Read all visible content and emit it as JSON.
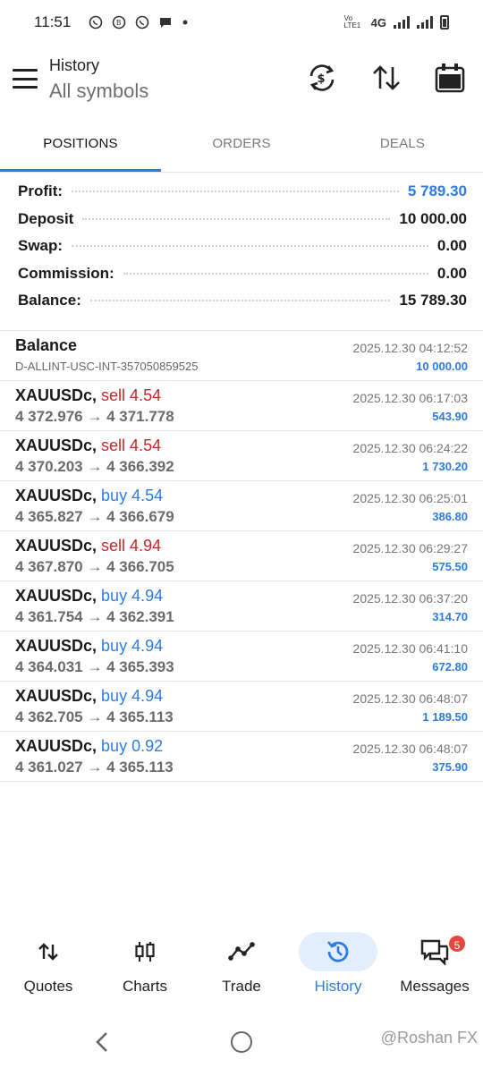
{
  "status_bar": {
    "time": "11:51",
    "network": "4G",
    "volte": "Vo LTE1",
    "icons": [
      "whatsapp-icon",
      "whatsapp-business-icon",
      "whatsapp-icon",
      "chat-icon",
      "dot"
    ]
  },
  "header": {
    "title": "History",
    "subtitle": "All symbols"
  },
  "tabs": [
    {
      "label": "POSITIONS",
      "active": true
    },
    {
      "label": "ORDERS",
      "active": false
    },
    {
      "label": "DEALS",
      "active": false
    }
  ],
  "summary": {
    "profit_label": "Profit:",
    "profit_value": "5 789.30",
    "deposit_label": "Deposit",
    "deposit_value": "10 000.00",
    "swap_label": "Swap:",
    "swap_value": "0.00",
    "commission_label": "Commission:",
    "commission_value": "0.00",
    "balance_label": "Balance:",
    "balance_value": "15 789.30"
  },
  "balance_entry": {
    "title": "Balance",
    "account": "D-ALLINT-USC-INT-357050859525",
    "time": "2025.12.30 04:12:52",
    "amount": "10 000.00"
  },
  "deals": [
    {
      "symbol": "XAUUSDc,",
      "side": "sell 4.54",
      "type": "sell",
      "prices": "4 372.976 → 4 371.778",
      "time": "2025.12.30 06:17:03",
      "profit": "543.90"
    },
    {
      "symbol": "XAUUSDc,",
      "side": "sell 4.54",
      "type": "sell",
      "prices": "4 370.203 → 4 366.392",
      "time": "2025.12.30 06:24:22",
      "profit": "1 730.20"
    },
    {
      "symbol": "XAUUSDc,",
      "side": "buy 4.54",
      "type": "buy",
      "prices": "4 365.827 → 4 366.679",
      "time": "2025.12.30 06:25:01",
      "profit": "386.80"
    },
    {
      "symbol": "XAUUSDc,",
      "side": "sell 4.94",
      "type": "sell",
      "prices": "4 367.870 → 4 366.705",
      "time": "2025.12.30 06:29:27",
      "profit": "575.50"
    },
    {
      "symbol": "XAUUSDc,",
      "side": "buy 4.94",
      "type": "buy",
      "prices": "4 361.754 → 4 362.391",
      "time": "2025.12.30 06:37:20",
      "profit": "314.70"
    },
    {
      "symbol": "XAUUSDc,",
      "side": "buy 4.94",
      "type": "buy",
      "prices": "4 364.031 → 4 365.393",
      "time": "2025.12.30 06:41:10",
      "profit": "672.80"
    },
    {
      "symbol": "XAUUSDc,",
      "side": "buy 4.94",
      "type": "buy",
      "prices": "4 362.705 → 4 365.113",
      "time": "2025.12.30 06:48:07",
      "profit": "1 189.50"
    },
    {
      "symbol": "XAUUSDc,",
      "side": "buy 0.92",
      "type": "buy",
      "prices": "4 361.027 → 4 365.113",
      "time": "2025.12.30 06:48:07",
      "profit": "375.90"
    }
  ],
  "bottom_nav": [
    {
      "label": "Quotes",
      "icon": "quotes-arrows-icon",
      "active": false
    },
    {
      "label": "Charts",
      "icon": "candlestick-icon",
      "active": false
    },
    {
      "label": "Trade",
      "icon": "trend-line-icon",
      "active": false
    },
    {
      "label": "History",
      "icon": "history-clock-icon",
      "active": true
    },
    {
      "label": "Messages",
      "icon": "messages-icon",
      "active": false,
      "badge": "5"
    }
  ],
  "watermark": "@Roshan FX",
  "colors": {
    "accent": "#2d7ce4",
    "sell": "#c62828",
    "buy": "#2d7ce4",
    "badge": "#e8463a"
  }
}
